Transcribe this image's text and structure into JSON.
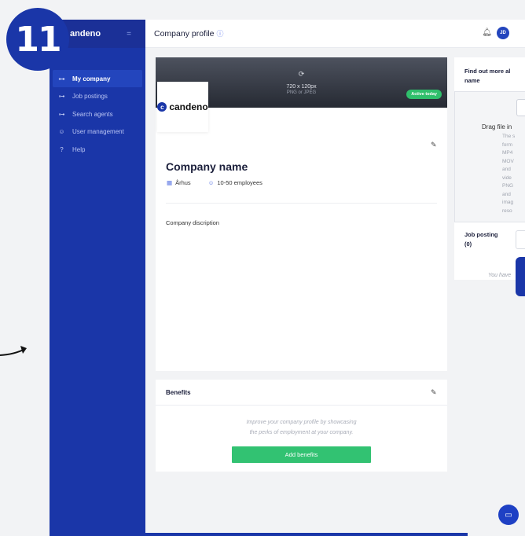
{
  "step_badge": "11",
  "sidebar": {
    "logo": "andeno",
    "menu_icon": "menu-collapse-icon",
    "items": [
      {
        "label": "My company",
        "icon": "company-icon",
        "active": true
      },
      {
        "label": "Job postings",
        "icon": "job-postings-icon",
        "active": false
      },
      {
        "label": "Search agents",
        "icon": "search-agents-icon",
        "active": false
      },
      {
        "label": "User management",
        "icon": "users-icon",
        "active": false
      },
      {
        "label": "Help",
        "icon": "help-icon",
        "active": false
      }
    ]
  },
  "topbar": {
    "title": "Company profile",
    "avatar_initials": "JD"
  },
  "profile": {
    "cover_size": "720 x 120px",
    "cover_format": "PNG or JPEG",
    "active_badge": "Active today",
    "logo_text": "candeno",
    "company_name": "Company name",
    "location": "Århus",
    "employees": "10-50 employees",
    "description": "Company discription"
  },
  "benefits": {
    "title": "Benefits",
    "empty_text_line1": "Improve your company profile by showcasing",
    "empty_text_line2": "the perks of employment at your company.",
    "add_button": "Add benefits"
  },
  "right_panel": {
    "title_line1": "Find out more al",
    "title_line2": "name",
    "drag_title": "Drag file in",
    "drag_lines": [
      "The s",
      "form",
      "MP4",
      "MOV",
      "and",
      "vide",
      "PNG",
      "and",
      "imag",
      "reso"
    ],
    "job_posting_line1": "Job posting",
    "job_posting_line2": "(0)",
    "empty_text": "You have"
  },
  "colors": {
    "primary": "#1a36a8",
    "success": "#32c272",
    "background": "#f2f3f5"
  }
}
